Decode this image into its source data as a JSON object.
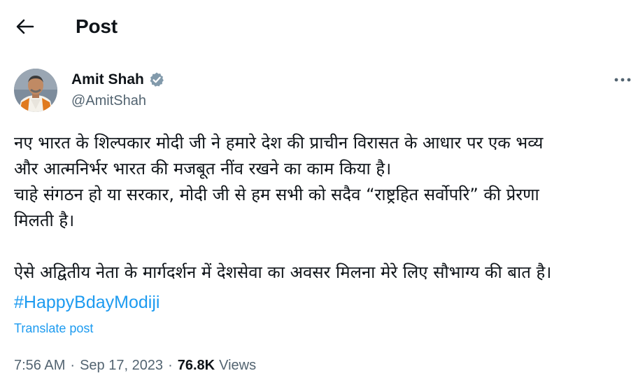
{
  "header": {
    "title": "Post",
    "back_icon": "arrow-left-icon"
  },
  "author": {
    "name": "Amit Shah",
    "handle": "@AmitShah",
    "verified_icon": "verified-badge-icon",
    "verified_color": "#829aab"
  },
  "more_icon": "more-horizontal-icon",
  "tweet": {
    "lines": [
      "नए भारत के शिल्पकार मोदी जी ने हमारे देश की प्राचीन विरासत के आधार पर एक भव्य",
      "और आत्मनिर्भर भारत की मजबूत नींव रखने का काम किया है।",
      "चाहे संगठन हो या सरकार, मोदी जी से हम सभी को सदैव “राष्ट्रहित सर्वोपरि” की प्रेरणा",
      "मिलती है।",
      "ऐसे अद्वितीय नेता के मार्गदर्शन में देशसेवा का अवसर मिलना मेरे लिए सौभाग्य की बात है।"
    ],
    "hashtag": "#HappyBdayModiji",
    "translate_label": "Translate post"
  },
  "meta": {
    "time": "7:56 AM",
    "separator": "·",
    "date": "Sep 17, 2023",
    "views_count": "76.8K",
    "views_label": "Views"
  },
  "colors": {
    "text": "#0f1419",
    "secondary": "#536471",
    "link": "#1d9bf0",
    "background": "#ffffff"
  }
}
